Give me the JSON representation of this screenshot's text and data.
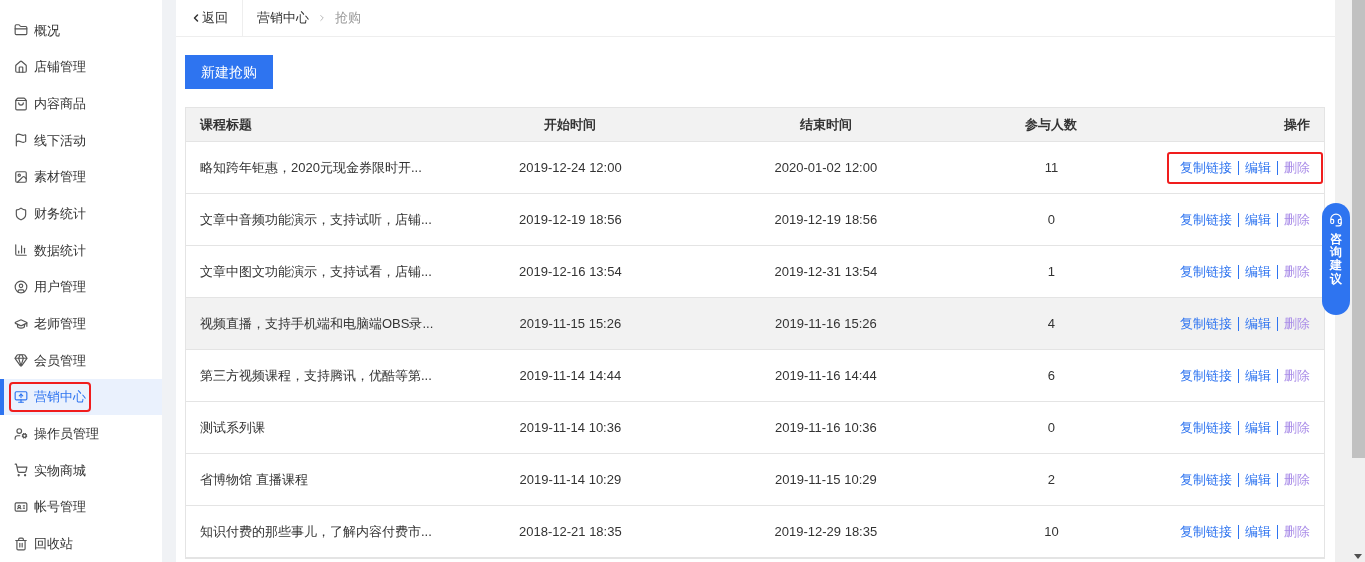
{
  "sidebar": {
    "items": [
      {
        "label": "概况",
        "selected": false,
        "highlighted": false
      },
      {
        "label": "店铺管理",
        "selected": false,
        "highlighted": false
      },
      {
        "label": "内容商品",
        "selected": false,
        "highlighted": false
      },
      {
        "label": "线下活动",
        "selected": false,
        "highlighted": false
      },
      {
        "label": "素材管理",
        "selected": false,
        "highlighted": false
      },
      {
        "label": "财务统计",
        "selected": false,
        "highlighted": false
      },
      {
        "label": "数据统计",
        "selected": false,
        "highlighted": false
      },
      {
        "label": "用户管理",
        "selected": false,
        "highlighted": false
      },
      {
        "label": "老师管理",
        "selected": false,
        "highlighted": false
      },
      {
        "label": "会员管理",
        "selected": false,
        "highlighted": false
      },
      {
        "label": "营销中心",
        "selected": true,
        "highlighted": true
      },
      {
        "label": "操作员管理",
        "selected": false,
        "highlighted": false
      },
      {
        "label": "实物商城",
        "selected": false,
        "highlighted": false
      },
      {
        "label": "帐号管理",
        "selected": false,
        "highlighted": false
      },
      {
        "label": "回收站",
        "selected": false,
        "highlighted": false
      }
    ]
  },
  "header": {
    "back": "返回",
    "breadcrumb": [
      "营销中心",
      "抢购"
    ]
  },
  "new_button": "新建抢购",
  "table": {
    "columns": [
      "课程标题",
      "开始时间",
      "结束时间",
      "参与人数",
      "操作"
    ],
    "rows": [
      {
        "title": "略知跨年钜惠，2020元现金券限时开...",
        "start": "2019-12-24 12:00",
        "end": "2020-01-02 12:00",
        "count": "11",
        "actions": [
          "复制链接",
          "编辑",
          "删除"
        ],
        "hovered": false,
        "highlighted": true
      },
      {
        "title": "文章中音频功能演示，支持试听，店铺...",
        "start": "2019-12-19 18:56",
        "end": "2019-12-19 18:56",
        "count": "0",
        "actions": [
          "复制链接",
          "编辑",
          "删除"
        ],
        "hovered": false,
        "highlighted": false
      },
      {
        "title": "文章中图文功能演示，支持试看，店铺...",
        "start": "2019-12-16 13:54",
        "end": "2019-12-31 13:54",
        "count": "1",
        "actions": [
          "复制链接",
          "编辑",
          "删除"
        ],
        "hovered": false,
        "highlighted": false
      },
      {
        "title": "视频直播，支持手机端和电脑端OBS录...",
        "start": "2019-11-15 15:26",
        "end": "2019-11-16 15:26",
        "count": "4",
        "actions": [
          "复制链接",
          "编辑",
          "删除"
        ],
        "hovered": true,
        "highlighted": false
      },
      {
        "title": "第三方视频课程，支持腾讯，优酷等第...",
        "start": "2019-11-14 14:44",
        "end": "2019-11-16 14:44",
        "count": "6",
        "actions": [
          "复制链接",
          "编辑",
          "删除"
        ],
        "hovered": false,
        "highlighted": false
      },
      {
        "title": "测试系列课",
        "start": "2019-11-14 10:36",
        "end": "2019-11-16 10:36",
        "count": "0",
        "actions": [
          "复制链接",
          "编辑",
          "删除"
        ],
        "hovered": false,
        "highlighted": false
      },
      {
        "title": "省博物馆 直播课程",
        "start": "2019-11-14 10:29",
        "end": "2019-11-15 10:29",
        "count": "2",
        "actions": [
          "复制链接",
          "编辑",
          "删除"
        ],
        "hovered": false,
        "highlighted": false
      },
      {
        "title": "知识付费的那些事儿，了解内容付费市...",
        "start": "2018-12-21 18:35",
        "end": "2019-12-29 18:35",
        "count": "10",
        "actions": [
          "复制链接",
          "编辑",
          "删除"
        ],
        "hovered": false,
        "highlighted": false
      }
    ]
  },
  "float_button": "咨询建议"
}
